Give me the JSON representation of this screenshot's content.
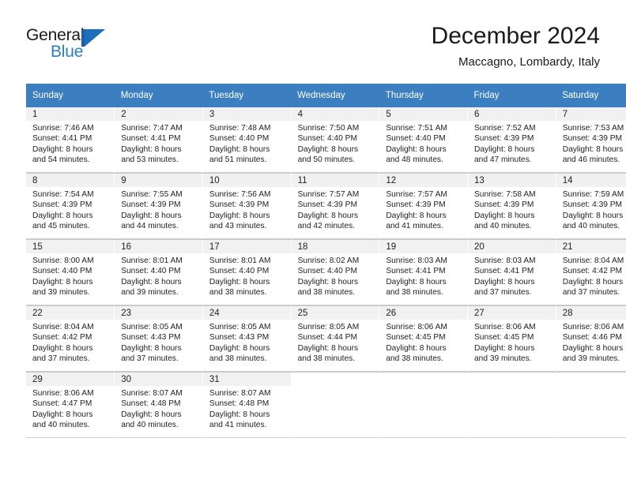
{
  "brand": {
    "name_part1": "General",
    "name_part2": "Blue",
    "logo_icon": "triangle-flag-mark",
    "color_blue": "#2a7fc9",
    "color_mark": "#1b6fbb"
  },
  "header": {
    "title": "December 2024",
    "location": "Maccagno, Lombardy, Italy"
  },
  "calendar": {
    "header_bg": "#3c7fc1",
    "daynum_bg": "#f1f1f1",
    "weekday_headers": [
      "Sunday",
      "Monday",
      "Tuesday",
      "Wednesday",
      "Thursday",
      "Friday",
      "Saturday"
    ],
    "weeks": [
      [
        {
          "day": "1",
          "sunrise": "Sunrise: 7:46 AM",
          "sunset": "Sunset: 4:41 PM",
          "daylight_line1": "Daylight: 8 hours",
          "daylight_line2": "and 54 minutes."
        },
        {
          "day": "2",
          "sunrise": "Sunrise: 7:47 AM",
          "sunset": "Sunset: 4:41 PM",
          "daylight_line1": "Daylight: 8 hours",
          "daylight_line2": "and 53 minutes."
        },
        {
          "day": "3",
          "sunrise": "Sunrise: 7:48 AM",
          "sunset": "Sunset: 4:40 PM",
          "daylight_line1": "Daylight: 8 hours",
          "daylight_line2": "and 51 minutes."
        },
        {
          "day": "4",
          "sunrise": "Sunrise: 7:50 AM",
          "sunset": "Sunset: 4:40 PM",
          "daylight_line1": "Daylight: 8 hours",
          "daylight_line2": "and 50 minutes."
        },
        {
          "day": "5",
          "sunrise": "Sunrise: 7:51 AM",
          "sunset": "Sunset: 4:40 PM",
          "daylight_line1": "Daylight: 8 hours",
          "daylight_line2": "and 48 minutes."
        },
        {
          "day": "6",
          "sunrise": "Sunrise: 7:52 AM",
          "sunset": "Sunset: 4:39 PM",
          "daylight_line1": "Daylight: 8 hours",
          "daylight_line2": "and 47 minutes."
        },
        {
          "day": "7",
          "sunrise": "Sunrise: 7:53 AM",
          "sunset": "Sunset: 4:39 PM",
          "daylight_line1": "Daylight: 8 hours",
          "daylight_line2": "and 46 minutes."
        }
      ],
      [
        {
          "day": "8",
          "sunrise": "Sunrise: 7:54 AM",
          "sunset": "Sunset: 4:39 PM",
          "daylight_line1": "Daylight: 8 hours",
          "daylight_line2": "and 45 minutes."
        },
        {
          "day": "9",
          "sunrise": "Sunrise: 7:55 AM",
          "sunset": "Sunset: 4:39 PM",
          "daylight_line1": "Daylight: 8 hours",
          "daylight_line2": "and 44 minutes."
        },
        {
          "day": "10",
          "sunrise": "Sunrise: 7:56 AM",
          "sunset": "Sunset: 4:39 PM",
          "daylight_line1": "Daylight: 8 hours",
          "daylight_line2": "and 43 minutes."
        },
        {
          "day": "11",
          "sunrise": "Sunrise: 7:57 AM",
          "sunset": "Sunset: 4:39 PM",
          "daylight_line1": "Daylight: 8 hours",
          "daylight_line2": "and 42 minutes."
        },
        {
          "day": "12",
          "sunrise": "Sunrise: 7:57 AM",
          "sunset": "Sunset: 4:39 PM",
          "daylight_line1": "Daylight: 8 hours",
          "daylight_line2": "and 41 minutes."
        },
        {
          "day": "13",
          "sunrise": "Sunrise: 7:58 AM",
          "sunset": "Sunset: 4:39 PM",
          "daylight_line1": "Daylight: 8 hours",
          "daylight_line2": "and 40 minutes."
        },
        {
          "day": "14",
          "sunrise": "Sunrise: 7:59 AM",
          "sunset": "Sunset: 4:39 PM",
          "daylight_line1": "Daylight: 8 hours",
          "daylight_line2": "and 40 minutes."
        }
      ],
      [
        {
          "day": "15",
          "sunrise": "Sunrise: 8:00 AM",
          "sunset": "Sunset: 4:40 PM",
          "daylight_line1": "Daylight: 8 hours",
          "daylight_line2": "and 39 minutes."
        },
        {
          "day": "16",
          "sunrise": "Sunrise: 8:01 AM",
          "sunset": "Sunset: 4:40 PM",
          "daylight_line1": "Daylight: 8 hours",
          "daylight_line2": "and 39 minutes."
        },
        {
          "day": "17",
          "sunrise": "Sunrise: 8:01 AM",
          "sunset": "Sunset: 4:40 PM",
          "daylight_line1": "Daylight: 8 hours",
          "daylight_line2": "and 38 minutes."
        },
        {
          "day": "18",
          "sunrise": "Sunrise: 8:02 AM",
          "sunset": "Sunset: 4:40 PM",
          "daylight_line1": "Daylight: 8 hours",
          "daylight_line2": "and 38 minutes."
        },
        {
          "day": "19",
          "sunrise": "Sunrise: 8:03 AM",
          "sunset": "Sunset: 4:41 PM",
          "daylight_line1": "Daylight: 8 hours",
          "daylight_line2": "and 38 minutes."
        },
        {
          "day": "20",
          "sunrise": "Sunrise: 8:03 AM",
          "sunset": "Sunset: 4:41 PM",
          "daylight_line1": "Daylight: 8 hours",
          "daylight_line2": "and 37 minutes."
        },
        {
          "day": "21",
          "sunrise": "Sunrise: 8:04 AM",
          "sunset": "Sunset: 4:42 PM",
          "daylight_line1": "Daylight: 8 hours",
          "daylight_line2": "and 37 minutes."
        }
      ],
      [
        {
          "day": "22",
          "sunrise": "Sunrise: 8:04 AM",
          "sunset": "Sunset: 4:42 PM",
          "daylight_line1": "Daylight: 8 hours",
          "daylight_line2": "and 37 minutes."
        },
        {
          "day": "23",
          "sunrise": "Sunrise: 8:05 AM",
          "sunset": "Sunset: 4:43 PM",
          "daylight_line1": "Daylight: 8 hours",
          "daylight_line2": "and 37 minutes."
        },
        {
          "day": "24",
          "sunrise": "Sunrise: 8:05 AM",
          "sunset": "Sunset: 4:43 PM",
          "daylight_line1": "Daylight: 8 hours",
          "daylight_line2": "and 38 minutes."
        },
        {
          "day": "25",
          "sunrise": "Sunrise: 8:05 AM",
          "sunset": "Sunset: 4:44 PM",
          "daylight_line1": "Daylight: 8 hours",
          "daylight_line2": "and 38 minutes."
        },
        {
          "day": "26",
          "sunrise": "Sunrise: 8:06 AM",
          "sunset": "Sunset: 4:45 PM",
          "daylight_line1": "Daylight: 8 hours",
          "daylight_line2": "and 38 minutes."
        },
        {
          "day": "27",
          "sunrise": "Sunrise: 8:06 AM",
          "sunset": "Sunset: 4:45 PM",
          "daylight_line1": "Daylight: 8 hours",
          "daylight_line2": "and 39 minutes."
        },
        {
          "day": "28",
          "sunrise": "Sunrise: 8:06 AM",
          "sunset": "Sunset: 4:46 PM",
          "daylight_line1": "Daylight: 8 hours",
          "daylight_line2": "and 39 minutes."
        }
      ],
      [
        {
          "day": "29",
          "sunrise": "Sunrise: 8:06 AM",
          "sunset": "Sunset: 4:47 PM",
          "daylight_line1": "Daylight: 8 hours",
          "daylight_line2": "and 40 minutes."
        },
        {
          "day": "30",
          "sunrise": "Sunrise: 8:07 AM",
          "sunset": "Sunset: 4:48 PM",
          "daylight_line1": "Daylight: 8 hours",
          "daylight_line2": "and 40 minutes."
        },
        {
          "day": "31",
          "sunrise": "Sunrise: 8:07 AM",
          "sunset": "Sunset: 4:48 PM",
          "daylight_line1": "Daylight: 8 hours",
          "daylight_line2": "and 41 minutes."
        },
        {
          "day": "",
          "sunrise": "",
          "sunset": "",
          "daylight_line1": "",
          "daylight_line2": ""
        },
        {
          "day": "",
          "sunrise": "",
          "sunset": "",
          "daylight_line1": "",
          "daylight_line2": ""
        },
        {
          "day": "",
          "sunrise": "",
          "sunset": "",
          "daylight_line1": "",
          "daylight_line2": ""
        },
        {
          "day": "",
          "sunrise": "",
          "sunset": "",
          "daylight_line1": "",
          "daylight_line2": ""
        }
      ]
    ]
  }
}
